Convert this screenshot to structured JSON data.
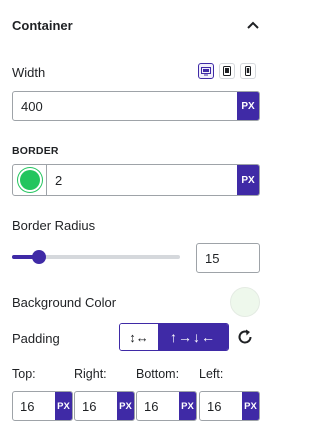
{
  "section": {
    "title": "Container"
  },
  "width": {
    "label": "Width",
    "value": "400",
    "unit": "PX"
  },
  "devices": [
    {
      "name": "desktop-icon",
      "active": true
    },
    {
      "name": "tablet-icon",
      "active": false
    },
    {
      "name": "mobile-icon",
      "active": false
    }
  ],
  "border": {
    "label": "BORDER",
    "color": "#22c55e",
    "value": "2",
    "unit": "PX"
  },
  "border_radius": {
    "label": "Border Radius",
    "value": "15",
    "slider_fraction": 0.16
  },
  "background": {
    "label": "Background Color",
    "color": "#eef8ec"
  },
  "padding": {
    "label": "Padding",
    "toggle_unlinked": "↕↔",
    "toggle_linked": "↑→↓←",
    "sides": [
      {
        "label": "Top:",
        "value": "16",
        "unit": "PX"
      },
      {
        "label": "Right:",
        "value": "16",
        "unit": "PX"
      },
      {
        "label": "Bottom:",
        "value": "16",
        "unit": "PX"
      },
      {
        "label": "Left:",
        "value": "16",
        "unit": "PX"
      }
    ]
  },
  "colors": {
    "accent": "#3f2aa6",
    "border": "#9ea3a8"
  }
}
